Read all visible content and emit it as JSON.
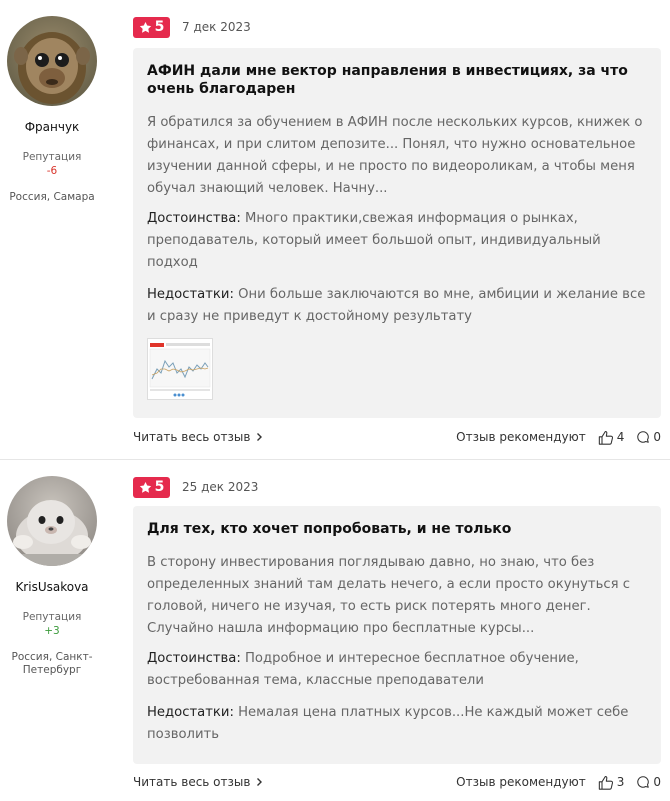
{
  "reviews": [
    {
      "author": {
        "name": "Франчук",
        "rep_label": "Репутация",
        "rep_value": "-6",
        "location": "Россия, Самара"
      },
      "rating": "5",
      "date": "7 дек 2023",
      "title": "АФИН дали мне вектор направления в инвестициях, за что очень благодарен",
      "text": "Я обратился за обучением в АФИН после нескольких курсов, книжек о финансах, и при слитом депозите... Понял, что нужно основательное изучении данной сферы, и не просто по видеороликам, а чтобы меня обучал знающий человек. Начну...",
      "pros_label": "Достоинства:",
      "pros": "Много практики,свежая информация о рынках, преподаватель, который имеет большой опыт, индивидуальный подход",
      "cons_label": "Недостатки:",
      "cons": "Они больше заключаются во мне, амбиции и желание все и сразу не приведут к достойному результату",
      "read_more": "Читать весь отзыв",
      "recommend": "Отзыв рекомендуют",
      "likes": "4",
      "comments": "0"
    },
    {
      "author": {
        "name": "KrisUsakova",
        "rep_label": "Репутация",
        "rep_value": "+3",
        "location": "Россия, Санкт-Петербург"
      },
      "rating": "5",
      "date": "25 дек 2023",
      "title": "Для тех, кто хочет попробовать, и не только",
      "text": "В сторону инвестирования поглядываю давно, но знаю, что без определенных знаний там делать нечего, а если просто окунуться с головой, ничего не изучая, то есть риск потерять много денег. Случайно нашла информацию про бесплатные курсы...",
      "pros_label": "Достоинства:",
      "pros": "Подробное и интересное бесплатное обучение, востребованная тема, классные преподаватели",
      "cons_label": "Недостатки:",
      "cons": "Немалая цена платных курсов...Не каждый может себе позволить",
      "read_more": "Читать весь отзыв",
      "recommend": "Отзыв рекомендуют",
      "likes": "3",
      "comments": "0"
    }
  ],
  "colors": {
    "badge": "#e52a4d",
    "card_bg": "#f2f2f2",
    "rep_negative": "#d9342b",
    "rep_positive": "#3a9a3a"
  },
  "icons": {
    "star": "star-icon",
    "chevron": "chevron-right-icon",
    "like": "thumbs-up-icon",
    "comment": "comment-bubble-icon"
  }
}
